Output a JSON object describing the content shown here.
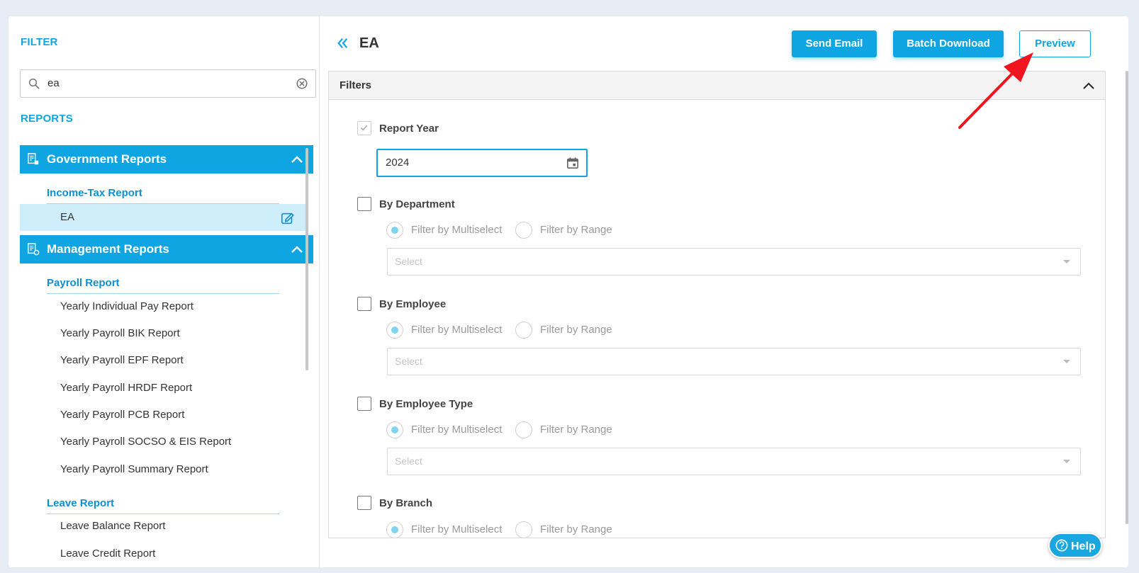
{
  "sidebar": {
    "filter_label": "FILTER",
    "search": {
      "value": "ea",
      "placeholder": ""
    },
    "reports_label": "REPORTS",
    "groups": [
      {
        "label": "Government Reports",
        "categories": [
          {
            "label": "Income-Tax Report",
            "items": [
              {
                "label": "EA",
                "active": true
              }
            ]
          }
        ]
      },
      {
        "label": "Management Reports",
        "categories": [
          {
            "label": "Payroll Report",
            "items": [
              {
                "label": "Yearly Individual Pay Report"
              },
              {
                "label": "Yearly Payroll BIK Report"
              },
              {
                "label": "Yearly Payroll EPF Report"
              },
              {
                "label": "Yearly Payroll HRDF Report"
              },
              {
                "label": "Yearly Payroll PCB Report"
              },
              {
                "label": "Yearly Payroll SOCSO & EIS Report"
              },
              {
                "label": "Yearly Payroll Summary Report"
              }
            ]
          },
          {
            "label": "Leave Report",
            "items": [
              {
                "label": "Leave Balance Report"
              },
              {
                "label": "Leave Credit Report"
              }
            ]
          }
        ]
      }
    ]
  },
  "header": {
    "title": "EA",
    "buttons": {
      "send_email": "Send Email",
      "batch_download": "Batch Download",
      "preview": "Preview"
    }
  },
  "filters": {
    "title": "Filters",
    "report_year": {
      "label": "Report Year",
      "value": "2024",
      "checked": true
    },
    "sections": [
      {
        "label": "By Department",
        "radio_multiselect": "Filter by Multiselect",
        "radio_range": "Filter by Range",
        "select_placeholder": "Select"
      },
      {
        "label": "By Employee",
        "radio_multiselect": "Filter by Multiselect",
        "radio_range": "Filter by Range",
        "select_placeholder": "Select"
      },
      {
        "label": "By Employee Type",
        "radio_multiselect": "Filter by Multiselect",
        "radio_range": "Filter by Range",
        "select_placeholder": "Select"
      },
      {
        "label": "By Branch",
        "radio_multiselect": "Filter by Multiselect",
        "radio_range": "Filter by Range"
      }
    ]
  },
  "help": {
    "label": "Help"
  },
  "colors": {
    "accent": "#0ea5e2",
    "active_row": "#cfeefb",
    "annotation_arrow": "#f0141e"
  }
}
